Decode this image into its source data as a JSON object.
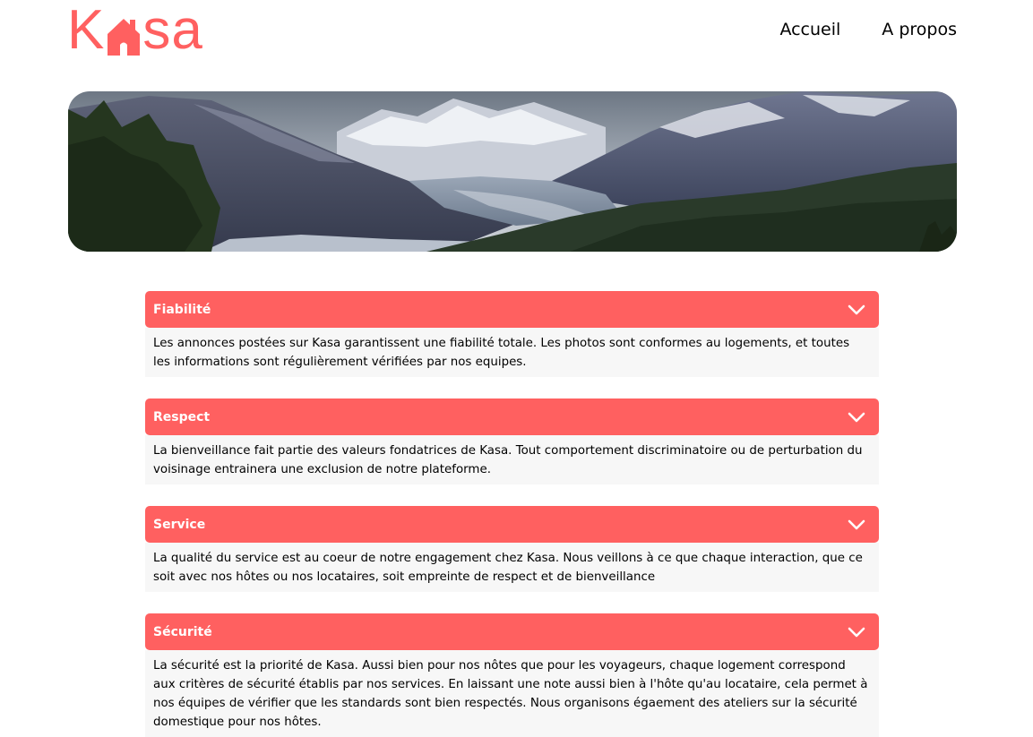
{
  "header": {
    "logo": {
      "part1": "K",
      "part2": "sa",
      "icon": "house-icon"
    },
    "nav": [
      {
        "label": "Accueil"
      },
      {
        "label": "A propos"
      }
    ]
  },
  "banner": {
    "icon": "mountain-landscape"
  },
  "colors": {
    "accent": "#FF6060",
    "body_bg": "#F7F7F7",
    "text": "#000000",
    "on_accent": "#FFFFFF"
  },
  "accordion": [
    {
      "title": "Fiabilité",
      "icon": "chevron-down-icon",
      "text": "Les annonces postées sur Kasa garantissent une fiabilité totale. Les photos sont conformes au logements, et toutes les informations sont régulièrement vérifiées par nos equipes."
    },
    {
      "title": "Respect",
      "icon": "chevron-down-icon",
      "text": "La bienveillance fait partie des valeurs fondatrices de Kasa. Tout comportement discriminatoire ou de perturbation du voisinage entrainera une exclusion de notre plateforme."
    },
    {
      "title": "Service",
      "icon": "chevron-down-icon",
      "text": "La qualité du service est au coeur de notre engagement chez Kasa. Nous veillons à ce que chaque interaction, que ce soit avec nos hôtes ou nos locataires, soit empreinte de respect et de bienveillance"
    },
    {
      "title": "Sécurité",
      "icon": "chevron-down-icon",
      "text": "La sécurité est la priorité de Kasa. Aussi bien pour nos nôtes que pour les voyageurs, chaque logement correspond aux critères de sécurité établis par nos services. En laissant une note aussi bien à l'hôte qu'au locataire, cela permet à nos équipes de vérifier que les standards sont bien respectés. Nous organisons égaement des ateliers sur la sécurité domestique pour nos hôtes."
    }
  ]
}
